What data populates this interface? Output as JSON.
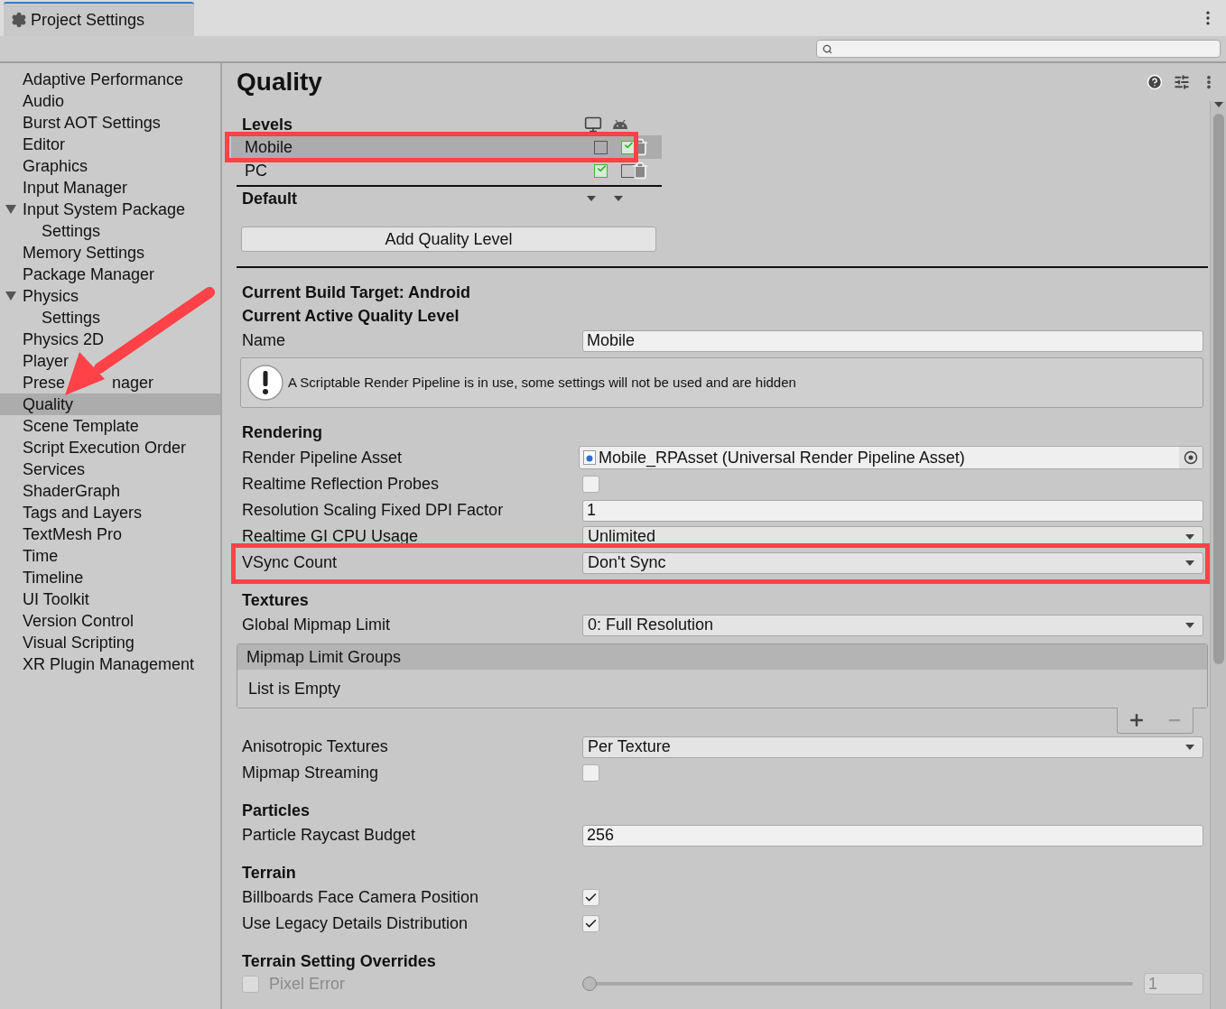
{
  "window": {
    "tab": "Project Settings"
  },
  "sidebar": {
    "items": [
      {
        "label": "Adaptive Performance",
        "selected": false
      },
      {
        "label": "Audio",
        "selected": false
      },
      {
        "label": "Burst AOT Settings",
        "selected": false
      },
      {
        "label": "Editor",
        "selected": false
      },
      {
        "label": "Graphics",
        "selected": false
      },
      {
        "label": "Input Manager",
        "selected": false
      },
      {
        "label": "Input System Package",
        "selected": false,
        "expanded": true,
        "children": [
          {
            "label": "Settings",
            "selected": false
          }
        ]
      },
      {
        "label": "Memory Settings",
        "selected": false
      },
      {
        "label": "Package Manager",
        "selected": false
      },
      {
        "label": "Physics",
        "selected": false,
        "expanded": true,
        "children": [
          {
            "label": "Settings",
            "selected": false
          }
        ]
      },
      {
        "label": "Physics 2D",
        "selected": false
      },
      {
        "label": "Player",
        "selected": false
      },
      {
        "label": "Prese",
        "label_tail": "nager",
        "selected": false
      },
      {
        "label": "Quality",
        "selected": true
      },
      {
        "label": "Scene Template",
        "selected": false
      },
      {
        "label": "Script Execution Order",
        "selected": false
      },
      {
        "label": "Services",
        "selected": false
      },
      {
        "label": "ShaderGraph",
        "selected": false
      },
      {
        "label": "Tags and Layers",
        "selected": false
      },
      {
        "label": "TextMesh Pro",
        "selected": false
      },
      {
        "label": "Time",
        "selected": false
      },
      {
        "label": "Timeline",
        "selected": false
      },
      {
        "label": "UI Toolkit",
        "selected": false
      },
      {
        "label": "Version Control",
        "selected": false
      },
      {
        "label": "Visual Scripting",
        "selected": false
      },
      {
        "label": "XR Plugin Management",
        "selected": false
      }
    ]
  },
  "page": {
    "title": "Quality"
  },
  "levels": {
    "heading": "Levels",
    "default_label": "Default",
    "add_button": "Add Quality Level",
    "rows": [
      {
        "name": "Mobile",
        "selected": true,
        "annotated": true,
        "platforms": [
          {
            "checked": false
          },
          {
            "checked": true
          }
        ]
      },
      {
        "name": "PC",
        "selected": false,
        "annotated": false,
        "platforms": [
          {
            "checked": true
          },
          {
            "checked": false
          }
        ]
      }
    ]
  },
  "current": {
    "build_target": "Current Build Target: Android",
    "active_level": "Current Active Quality Level"
  },
  "properties": [
    {
      "kind": "field",
      "label": "Name",
      "value": "Mobile"
    },
    {
      "kind": "warning",
      "text": "A Scriptable Render Pipeline is in use, some settings will not be used and are hidden"
    },
    {
      "kind": "heading",
      "label": "Rendering"
    },
    {
      "kind": "object",
      "label": "Render Pipeline Asset",
      "value": "Mobile_RPAsset (Universal Render Pipeline Asset)"
    },
    {
      "kind": "checkbox",
      "label": "Realtime Reflection Probes",
      "checked": false
    },
    {
      "kind": "field",
      "label": "Resolution Scaling Fixed DPI Factor",
      "value": "1"
    },
    {
      "kind": "dropdown",
      "label": "Realtime GI CPU Usage",
      "value": "Unlimited"
    },
    {
      "kind": "dropdown",
      "label": "VSync Count",
      "value": "Don't Sync",
      "annotated": true
    },
    {
      "kind": "heading",
      "label": "Textures"
    },
    {
      "kind": "dropdown",
      "label": "Global Mipmap Limit",
      "value": "0: Full Resolution"
    },
    {
      "kind": "list",
      "title": "Mipmap Limit Groups",
      "empty_text": "List is Empty"
    },
    {
      "kind": "dropdown",
      "label": "Anisotropic Textures",
      "value": "Per Texture"
    },
    {
      "kind": "checkbox",
      "label": "Mipmap Streaming",
      "checked": false
    },
    {
      "kind": "heading",
      "label": "Particles"
    },
    {
      "kind": "field",
      "label": "Particle Raycast Budget",
      "value": "256"
    },
    {
      "kind": "heading",
      "label": "Terrain"
    },
    {
      "kind": "checkbox",
      "label": "Billboards Face Camera Position",
      "checked": true
    },
    {
      "kind": "checkbox",
      "label": "Use Legacy Details Distribution",
      "checked": true
    },
    {
      "kind": "heading",
      "label": "Terrain Setting Overrides"
    },
    {
      "kind": "override_slider",
      "label": "Pixel Error",
      "enabled": false,
      "level": 0,
      "value": "1"
    }
  ]
}
